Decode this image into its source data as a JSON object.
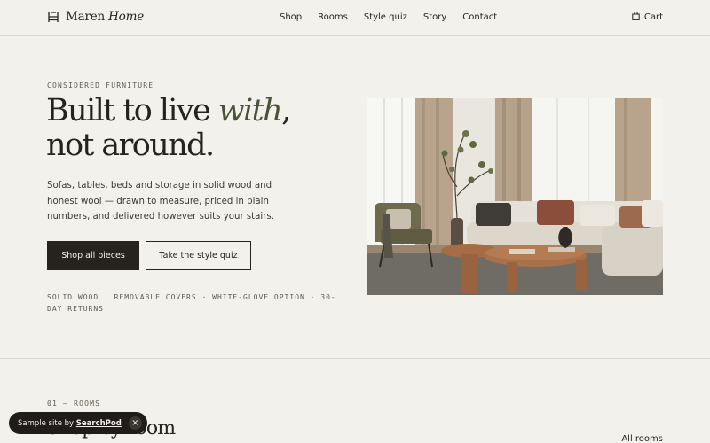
{
  "brand": {
    "name": "Maren",
    "name_italic": "Home"
  },
  "nav": {
    "items": [
      "Shop",
      "Rooms",
      "Style quiz",
      "Story",
      "Contact"
    ]
  },
  "cart": {
    "label": "Cart"
  },
  "hero": {
    "eyebrow": "CONSIDERED FURNITURE",
    "headline_pre": "Built to live ",
    "headline_em": "with",
    "headline_post": ",",
    "headline_line2": "not around.",
    "intro": "Sofas, tables, beds and storage in solid wood and honest wool — drawn to measure, priced in plain numbers, and delivered however suits your stairs.",
    "primary_cta": "Shop all pieces",
    "secondary_cta": "Take the style quiz",
    "features": "SOLID WOOD · REMOVABLE COVERS · WHITE-GLOVE OPTION · 30-DAY RETURNS"
  },
  "rooms_section": {
    "eyebrow": "01 — ROOMS",
    "title": "Shop by room",
    "all_link": "All rooms"
  },
  "toast": {
    "prefix": "Sample site by ",
    "brand": "SearchPod",
    "close": "×"
  },
  "colors": {
    "background": "#f3f1eb",
    "ink": "#26231f",
    "accent_olive": "#4a5238"
  },
  "icons": {
    "logo": "chair-icon",
    "cart": "bag-icon",
    "toast_close": "close-icon"
  }
}
